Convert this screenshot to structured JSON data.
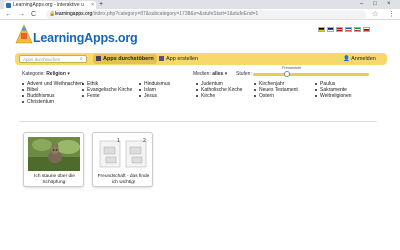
{
  "browser": {
    "tab_title": "LearningApps.org - interaktive u",
    "tab_close": "×",
    "new_tab": "+",
    "minimize": "–",
    "maximize": "□",
    "close": "×",
    "back": "←",
    "forward": "→",
    "reload": "C",
    "url_host": "learningapps.org",
    "url_path": "/index.php?category=87&subcategory=1738&s=&stufeStart=1&stufeEnd=1",
    "menu": "⋮",
    "star": "☆"
  },
  "site": {
    "logo_text": "LearningApps.org",
    "flags": [
      {
        "name": "de",
        "colors": [
          "#000000",
          "#dd0000",
          "#ffce00"
        ]
      },
      {
        "name": "gb",
        "colors": [
          "#012169",
          "#c8102e",
          "#ffffff"
        ]
      },
      {
        "name": "es",
        "colors": [
          "#aa151b",
          "#f1bf00",
          "#aa151b"
        ]
      },
      {
        "name": "fr",
        "colors": [
          "#0055a4",
          "#ffffff",
          "#ef4135"
        ]
      },
      {
        "name": "it",
        "colors": [
          "#009246",
          "#ffffff",
          "#ce2b37"
        ]
      },
      {
        "name": "ru",
        "colors": [
          "#ffffff",
          "#0039a6",
          "#d52b1e"
        ]
      }
    ]
  },
  "nav": {
    "search_placeholder": "Apps durchsuchen",
    "browse_label": "Apps durchstöbern",
    "create_label": "App erstellen",
    "login_label": "Anmelden",
    "accent_color": "#f7d96b"
  },
  "filters": {
    "category_label": "Kategorie:",
    "category_value": "Religion",
    "media_label": "Medien:",
    "media_value": "alles",
    "level_label": "Stufen:",
    "slider_label": "Primarstufe"
  },
  "categories": [
    [
      "Advent und Weihnachten",
      "Bibel",
      "Buddhismus",
      "Christentum"
    ],
    [
      "Ethik",
      "Evangelische Kirche",
      "Feste"
    ],
    [
      "Hinduismus",
      "Islam",
      "Jesus"
    ],
    [
      "Judentum",
      "Katholische Kirche",
      "Kirche"
    ],
    [
      "Kirchenjahr",
      "Neues Testament",
      "Ostern"
    ],
    [
      "Paulus",
      "Sakramente",
      "Weltreligionen"
    ]
  ],
  "apps": [
    {
      "title": "Ich staune über die Schöpfung:"
    },
    {
      "title": "Freundschaft - das finde ich wichtig!"
    }
  ]
}
